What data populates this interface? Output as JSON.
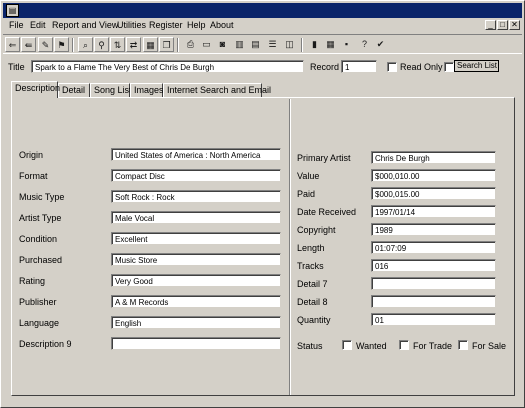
{
  "menu": [
    "File",
    "Edit",
    "Report and View",
    "Utilities",
    "Register",
    "Help",
    "About"
  ],
  "window_buttons": {
    "minimize": "_",
    "restore": "□",
    "close": "✕"
  },
  "toolbar": {
    "icons": [
      "open-icon",
      "prev-record-icon",
      "edit-icon",
      "bookmark-icon",
      "find-icon",
      "filter-icon",
      "sort-icon",
      "replace-icon",
      "grid-icon",
      "copy-icon",
      "print-icon",
      "preview-icon",
      "camera-icon",
      "chart-icon",
      "table-icon",
      "report-icon",
      "label-icon",
      "calculator-icon",
      "spreadsheet-icon",
      "save-icon",
      "help-icon",
      "check-icon"
    ]
  },
  "header": {
    "title_label": "Title",
    "title_value": "Spark to a Flame The Very Best of Chris De Burgh",
    "record_label": "Record",
    "record_value": "1",
    "read_only_label": "Read Only",
    "search_list_label": "Search List"
  },
  "tabs": [
    "Description",
    "Detail",
    "Song List",
    "Images",
    "Internet Search and Email"
  ],
  "left_fields": [
    {
      "label": "Origin",
      "value": "United States of America : North America"
    },
    {
      "label": "Format",
      "value": "Compact Disc"
    },
    {
      "label": "Music Type",
      "value": "Soft Rock : Rock"
    },
    {
      "label": "Artist Type",
      "value": "Male Vocal"
    },
    {
      "label": "Condition",
      "value": "Excellent"
    },
    {
      "label": "Purchased",
      "value": "Music Store"
    },
    {
      "label": "Rating",
      "value": "Very Good"
    },
    {
      "label": "Publisher",
      "value": "A & M Records"
    },
    {
      "label": "Language",
      "value": "English"
    },
    {
      "label": "Description 9",
      "value": ""
    }
  ],
  "right_fields": [
    {
      "label": "Primary Artist",
      "value": "Chris De Burgh"
    },
    {
      "label": "Value",
      "value": "$000,010.00"
    },
    {
      "label": "Paid",
      "value": "$000,015.00"
    },
    {
      "label": "Date Received",
      "value": "1997/01/14"
    },
    {
      "label": "Copyright",
      "value": "1989"
    },
    {
      "label": "Length",
      "value": "01:07:09"
    },
    {
      "label": "Tracks",
      "value": "016"
    },
    {
      "label": "Detail 7",
      "value": ""
    },
    {
      "label": "Detail 8",
      "value": ""
    },
    {
      "label": "Quantity",
      "value": "01"
    }
  ],
  "status": {
    "label": "Status",
    "options": [
      "Wanted",
      "For Trade",
      "For Sale"
    ]
  }
}
